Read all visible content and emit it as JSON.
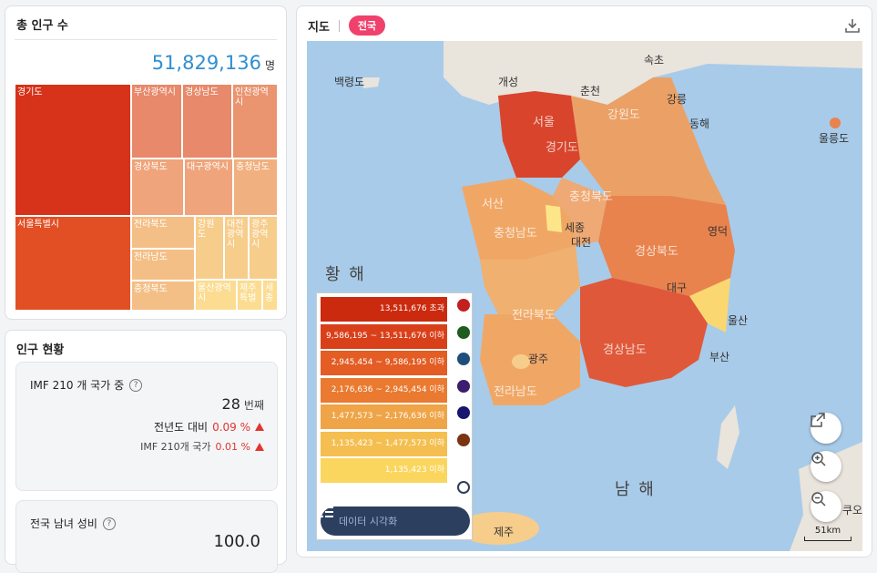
{
  "total": {
    "title": "총 인구 수",
    "value": "51,829,136",
    "unit": "명",
    "treemap": [
      {
        "label": "경기도",
        "color": "#d7321a"
      },
      {
        "label": "서울특별시",
        "color": "#e24f24"
      },
      {
        "label": "부산광역시",
        "color": "#e7896a"
      },
      {
        "label": "경상남도",
        "color": "#e7896a"
      },
      {
        "label": "인천광역시",
        "color": "#ea9470"
      },
      {
        "label": "경상북도",
        "color": "#efa47b"
      },
      {
        "label": "대구광역시",
        "color": "#efa47b"
      },
      {
        "label": "충청남도",
        "color": "#f1b07f"
      },
      {
        "label": "전라북도",
        "color": "#f4bf86"
      },
      {
        "label": "전라남도",
        "color": "#f4bf86"
      },
      {
        "label": "충청북도",
        "color": "#f4bf86"
      },
      {
        "label": "강원도",
        "color": "#f7cd8b"
      },
      {
        "label": "대전광역시",
        "color": "#f7cd8b"
      },
      {
        "label": "광주광역시",
        "color": "#f7cd8b"
      },
      {
        "label": "울산광역시",
        "color": "#fbdc91"
      },
      {
        "label": "제주특별",
        "color": "#fbdc91"
      },
      {
        "label": "세종",
        "color": "#fbdc91"
      }
    ]
  },
  "status": {
    "title": "인구 현황",
    "imf": {
      "label": "IMF 210 개 국가 중",
      "rank": "28",
      "rank_unit": "번째",
      "yoy_label": "전년도 대비",
      "yoy_value": "0.09 %",
      "imf_label": "IMF 210개 국가",
      "imf_value": "0.01 %"
    },
    "ratio": {
      "label": "전국 남녀 성비",
      "value": "100.0"
    }
  },
  "map": {
    "title": "지도",
    "scope": "전국",
    "labels": {
      "baengnyeong": "백령도",
      "gaeseong": "개성",
      "sokcho": "속초",
      "chuncheon": "춘천",
      "gangneung": "강릉",
      "donghae": "동해",
      "seoul": "서울",
      "gyeonggi": "경기도",
      "gangwon": "강원도",
      "ulleung": "울릉도",
      "chungbuk": "충청북도",
      "seosan": "서산",
      "chungnam": "충청남도",
      "sejong": "세종",
      "daejeon": "대전",
      "yeongdeok": "영덕",
      "gyeongbuk": "경상북도",
      "yellow_sea": "황 해",
      "daegu": "대구",
      "jeonbuk": "전라북도",
      "ulsan": "울산",
      "gyeongnam": "경상남도",
      "busan": "부산",
      "gwangju": "광주",
      "jeonnam": "전라남도",
      "south_sea": "남 해",
      "jeju": "제주",
      "kyushu": "쿠오"
    },
    "legend": [
      {
        "text": "13,511,676 초과",
        "color": "#cc2a0e"
      },
      {
        "text": "9,586,195 ~ 13,511,676 이하",
        "color": "#d9401a"
      },
      {
        "text": "2,945,454 ~ 9,586,195 이하",
        "color": "#e35d24"
      },
      {
        "text": "2,176,636 ~ 2,945,454 이하",
        "color": "#ea7a30"
      },
      {
        "text": "1,477,573 ~ 2,176,636 이하",
        "color": "#efa447"
      },
      {
        "text": "1,135,423 ~ 1,477,573 이하",
        "color": "#f4bf50"
      },
      {
        "text": "1,135,423 이하",
        "color": "#fbd65e"
      }
    ],
    "theme_dots": [
      "#c41e1e",
      "#1f5c1f",
      "#1e4f7a",
      "#3b1f6e",
      "#16166e",
      "#7a3510"
    ],
    "viz_button": "데이터 시각화",
    "scale": "51km"
  }
}
